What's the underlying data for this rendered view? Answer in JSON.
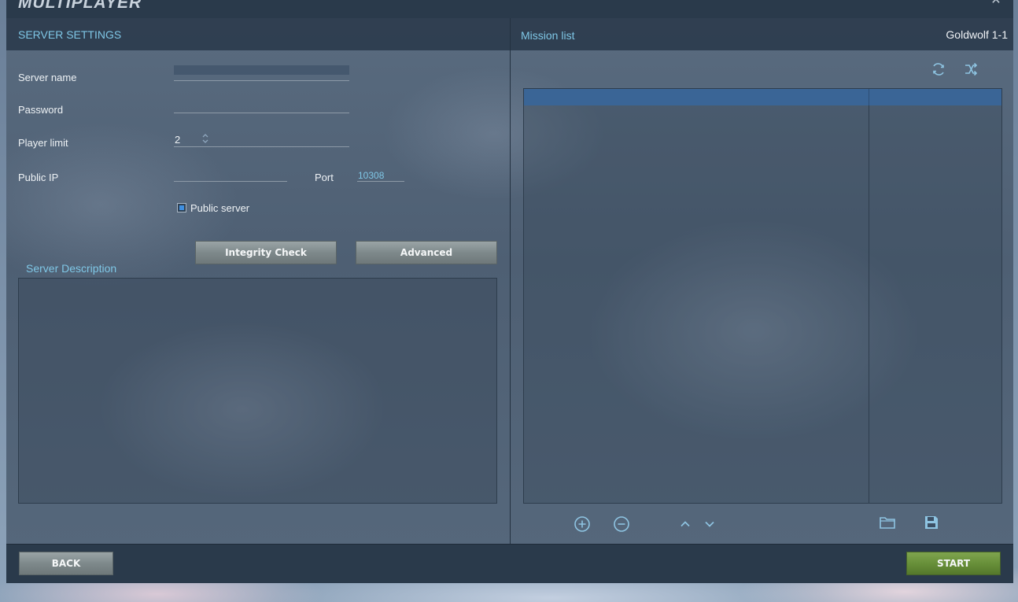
{
  "window": {
    "title": "MULTIPLAYER"
  },
  "left_panel": {
    "title": "SERVER SETTINGS",
    "fields": {
      "server_name": {
        "label": "Server name",
        "value": ""
      },
      "password": {
        "label": "Password",
        "value": ""
      },
      "player_limit": {
        "label": "Player limit",
        "value": "2"
      },
      "public_ip": {
        "label": "Public IP",
        "value": ""
      },
      "port": {
        "label": "Port",
        "value": "10308"
      }
    },
    "public_server": {
      "label": "Public server",
      "checked": true
    },
    "buttons": {
      "integrity_check": "Integrity Check",
      "advanced": "Advanced"
    },
    "description": {
      "title": "Server Description",
      "value": ""
    }
  },
  "right_panel": {
    "title": "Mission list",
    "current_mission": "Goldwolf 1-1",
    "toolbar_icons": [
      "refresh-icon",
      "shuffle-icon"
    ],
    "bottom_icons": [
      "add-icon",
      "remove-icon",
      "move-up-icon",
      "move-down-icon",
      "folder-icon",
      "save-icon"
    ],
    "rows": []
  },
  "footer": {
    "back": "BACK",
    "start": "START"
  },
  "colors": {
    "accent_text": "#7fc7e6",
    "header_row": "#3a6596",
    "start_button": "#68903a",
    "gray_button": "#7e898b",
    "panel_dark": "#2a3a4b"
  }
}
